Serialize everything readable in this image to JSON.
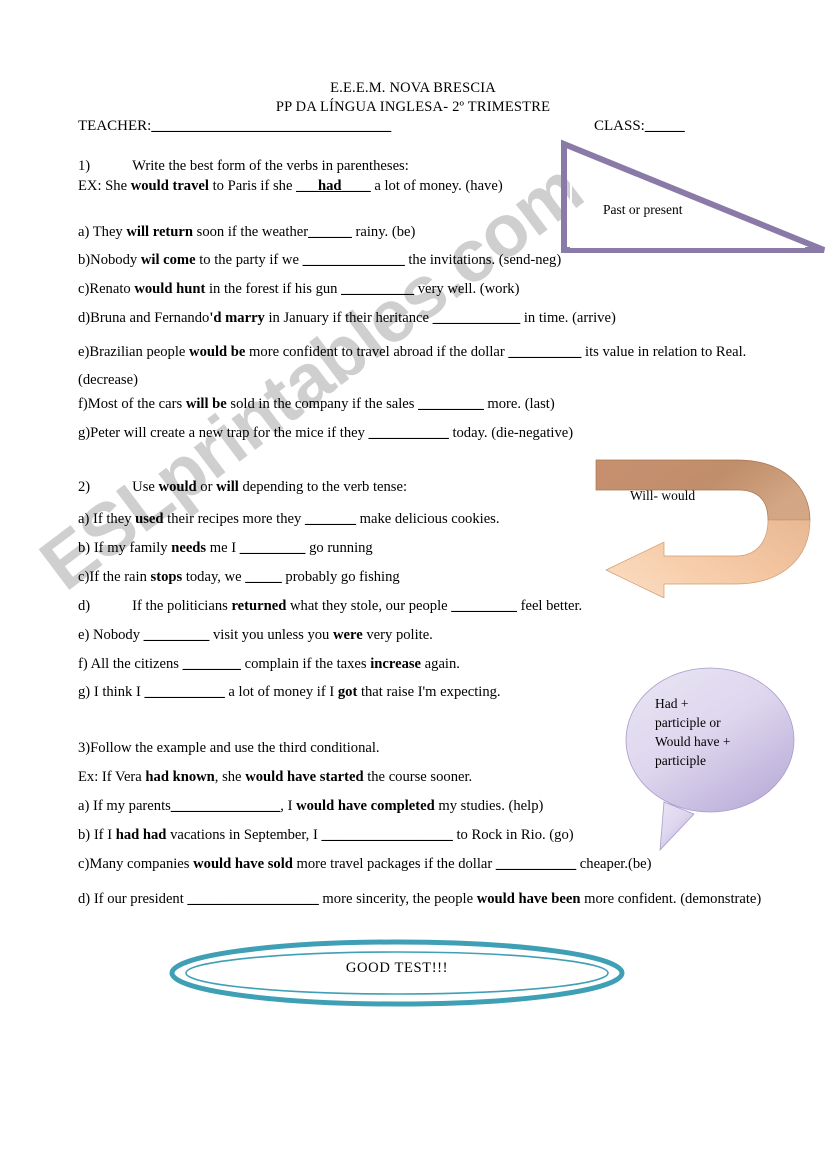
{
  "header": {
    "school": "E.E.E.M. NOVA BRESCIA",
    "subject": "PP DA LÍNGUA INGLESA- 2º TRIMESTRE",
    "teacher_label": "TEACHER:",
    "teacher_blank": "______________________________",
    "class_label": "CLASS:",
    "class_blank": "_____"
  },
  "exercise1": {
    "number": "1)",
    "instruction": "Write the best form of the verbs in parentheses:",
    "example": {
      "prefix": "EX: She ",
      "bold1": "would travel",
      "mid": " to Paris if she ",
      "answer_pre": "___",
      "answer": "had",
      "answer_post": "____",
      "suffix": " a lot of money. (have)"
    },
    "items": [
      {
        "letter": "a)",
        "pre": " They ",
        "bold": "will return",
        "mid": " soon if the weather",
        "blank": "______",
        "post": " rainy. (be)"
      },
      {
        "letter": "b)",
        "pre": "Nobody ",
        "bold": "wil come",
        "mid": " to the party if we ",
        "blank": "______________",
        "post": " the invitations. (send-neg)"
      },
      {
        "letter": "c)",
        "pre": "Renato ",
        "bold": "would hunt",
        "mid": " in the forest if his gun ",
        "blank": "__________",
        "post": " very well. (work)"
      },
      {
        "letter": "d)",
        "pre": "Bruna and Fernando",
        "bold": "'d marry",
        "mid": " in January if their heritance ",
        "blank": "____________",
        "post": " in time. (arrive)"
      },
      {
        "letter": "e)",
        "pre": "Brazilian people ",
        "bold": "would be",
        "mid": " more confident to travel abroad if the dollar ",
        "blank": "__________",
        "post": " its value in relation to Real. (decrease)"
      },
      {
        "letter": "f)",
        "pre": "Most of the cars ",
        "bold": "will be",
        "mid": " sold in the company if the sales ",
        "blank": "_________",
        "post": " more. (last)"
      },
      {
        "letter": "g)",
        "pre": "Peter will create a new trap for the mice if they ",
        "bold": "",
        "mid": "",
        "blank": "___________",
        "post": " today. (die-negative)"
      }
    ]
  },
  "exercise2": {
    "number": "2)",
    "instruction_pre": "Use ",
    "instruction_bold1": "would",
    "instruction_mid": " or ",
    "instruction_bold2": "will",
    "instruction_post": " depending to the verb tense:",
    "items": [
      {
        "letter": "a)",
        "pre": " If they ",
        "bold": "used",
        "mid": " their recipes more they ",
        "blank": "_______",
        "post": " make delicious cookies."
      },
      {
        "letter": "b)",
        "pre": " If my family ",
        "bold": "needs",
        "mid": " me I ",
        "blank": "_________",
        "post": " go running"
      },
      {
        "letter": "c)",
        "pre": "If the rain ",
        "bold": "stops",
        "mid": " today, we ",
        "blank": "_____",
        "post": " probably go fishing"
      },
      {
        "letter": "d)",
        "pre": "If the politicians ",
        "bold": "returned",
        "mid": " what they stole, our people ",
        "blank": "_________",
        "post": " feel better."
      },
      {
        "letter": "e)",
        "pre": " Nobody ",
        "bold": "",
        "mid": "",
        "blank": "_________",
        "post": " visit you unless you ",
        "bold2": "were",
        "post2": " very polite."
      },
      {
        "letter": "f)",
        "pre": " All the citizens ",
        "bold": "",
        "mid": "",
        "blank": "________",
        "post": " complain if the taxes ",
        "bold2": "increase",
        "post2": " again."
      },
      {
        "letter": "g)",
        "pre": " I think I ",
        "bold": "",
        "mid": "",
        "blank": "___________",
        "post": " a lot of money if I ",
        "bold2": "got",
        "post2": " that raise I'm expecting."
      }
    ]
  },
  "exercise3": {
    "number": "3)",
    "instruction": "Follow the example and use the third conditional.",
    "example": {
      "pre": "Ex: If Vera ",
      "bold1": "had known",
      "mid": ", she ",
      "bold2": "would have started",
      "post": " the course sooner."
    },
    "items": [
      {
        "letter": "a)",
        "pre": " If my parents",
        "blank": "_______________",
        "mid": ", I ",
        "bold": "would have completed",
        "post": " my studies. (help)"
      },
      {
        "letter": "b)",
        "pre": " If I ",
        "bold": "had had",
        "mid": " vacations in September, I ",
        "blank": "__________________",
        "post": " to Rock in Rio. (go)"
      },
      {
        "letter": "c)",
        "pre": "Many companies ",
        "bold": "would have sold",
        "mid": " more travel packages if the dollar ",
        "blank": "___________",
        "post": " cheaper.(be)"
      },
      {
        "letter": "d)",
        "pre": " If our president ",
        "blank": "__________________",
        "mid": " more sincerity, the people ",
        "bold": "would have been",
        "post": " more confident. (demonstrate)"
      }
    ]
  },
  "shapes": {
    "triangle_label": "Past or present",
    "triangle_color": "#8a7aa8",
    "arrow_label": "Will- would",
    "arrow_color_dark": "#c08e6a",
    "arrow_color_light": "#f5c9a4",
    "bubble_lines": [
      "Had +",
      "participle  or",
      "Would have +",
      "participle"
    ],
    "bubble_color_light": "#e3ddf0",
    "bubble_color_dark": "#b0a4cf",
    "oval_label": "GOOD TEST!!!",
    "oval_color": "#3fa0b5"
  },
  "watermark": {
    "text": "ESLprintables.com",
    "color": "#cfcfcf"
  }
}
